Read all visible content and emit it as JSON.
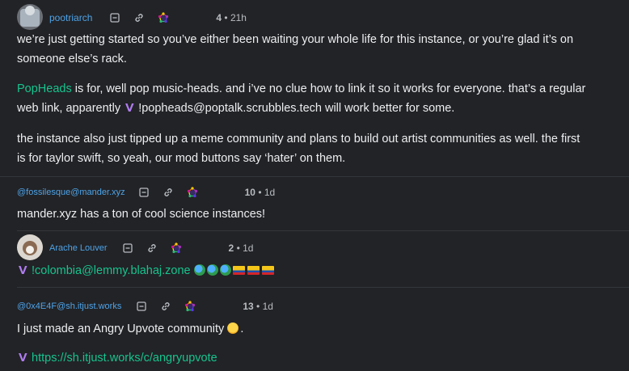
{
  "comments": [
    {
      "username": "pootriarch",
      "score": "4",
      "time": "21h",
      "paragraphs": {
        "p1_l1": "we’re just getting started so you’ve either been waiting your whole life for this instance, or you’re glad it’s on",
        "p1_l2": "someone else’s rack.",
        "p2_link": "PopHeads",
        "p2_l1_rest": " is for, well pop music-heads. and i’ve no clue how to link it so it works for everyone. that’s a regular",
        "p2_l2_a": "web link, apparently ",
        "p2_l2_b": " !popheads@poptalk.scrubbles.tech will work better for some.",
        "p3_l1": "the instance also just tipped up a meme community and plans to build out artist communities as well. the first",
        "p3_l2": "is for taylor swift, so yeah, our mod buttons say ‘hater’ on them."
      }
    },
    {
      "username": "@fossilesque@mander.xyz",
      "score": "10",
      "time": "1d",
      "text": "mander.xyz has a ton of cool science instances!"
    },
    {
      "username": "Arache Louver",
      "score": "2",
      "time": "1d",
      "link": "!colombia@lemmy.blahaj.zone"
    },
    {
      "username": "@0x4E4F@sh.itjust.works",
      "score": "13",
      "time": "1d",
      "text": "I just made an Angry Upvote community ",
      "link": "https://sh.itjust.works/c/angryupvote"
    }
  ],
  "separator": "•",
  "icons": {
    "collapse": "collapse-icon",
    "link": "link-icon",
    "fediverse": "fediverse-icon",
    "lemmy": "lemmy-icon"
  },
  "colors": {
    "background": "#222326",
    "username": "#4ea3e8",
    "link": "#17c38e"
  }
}
